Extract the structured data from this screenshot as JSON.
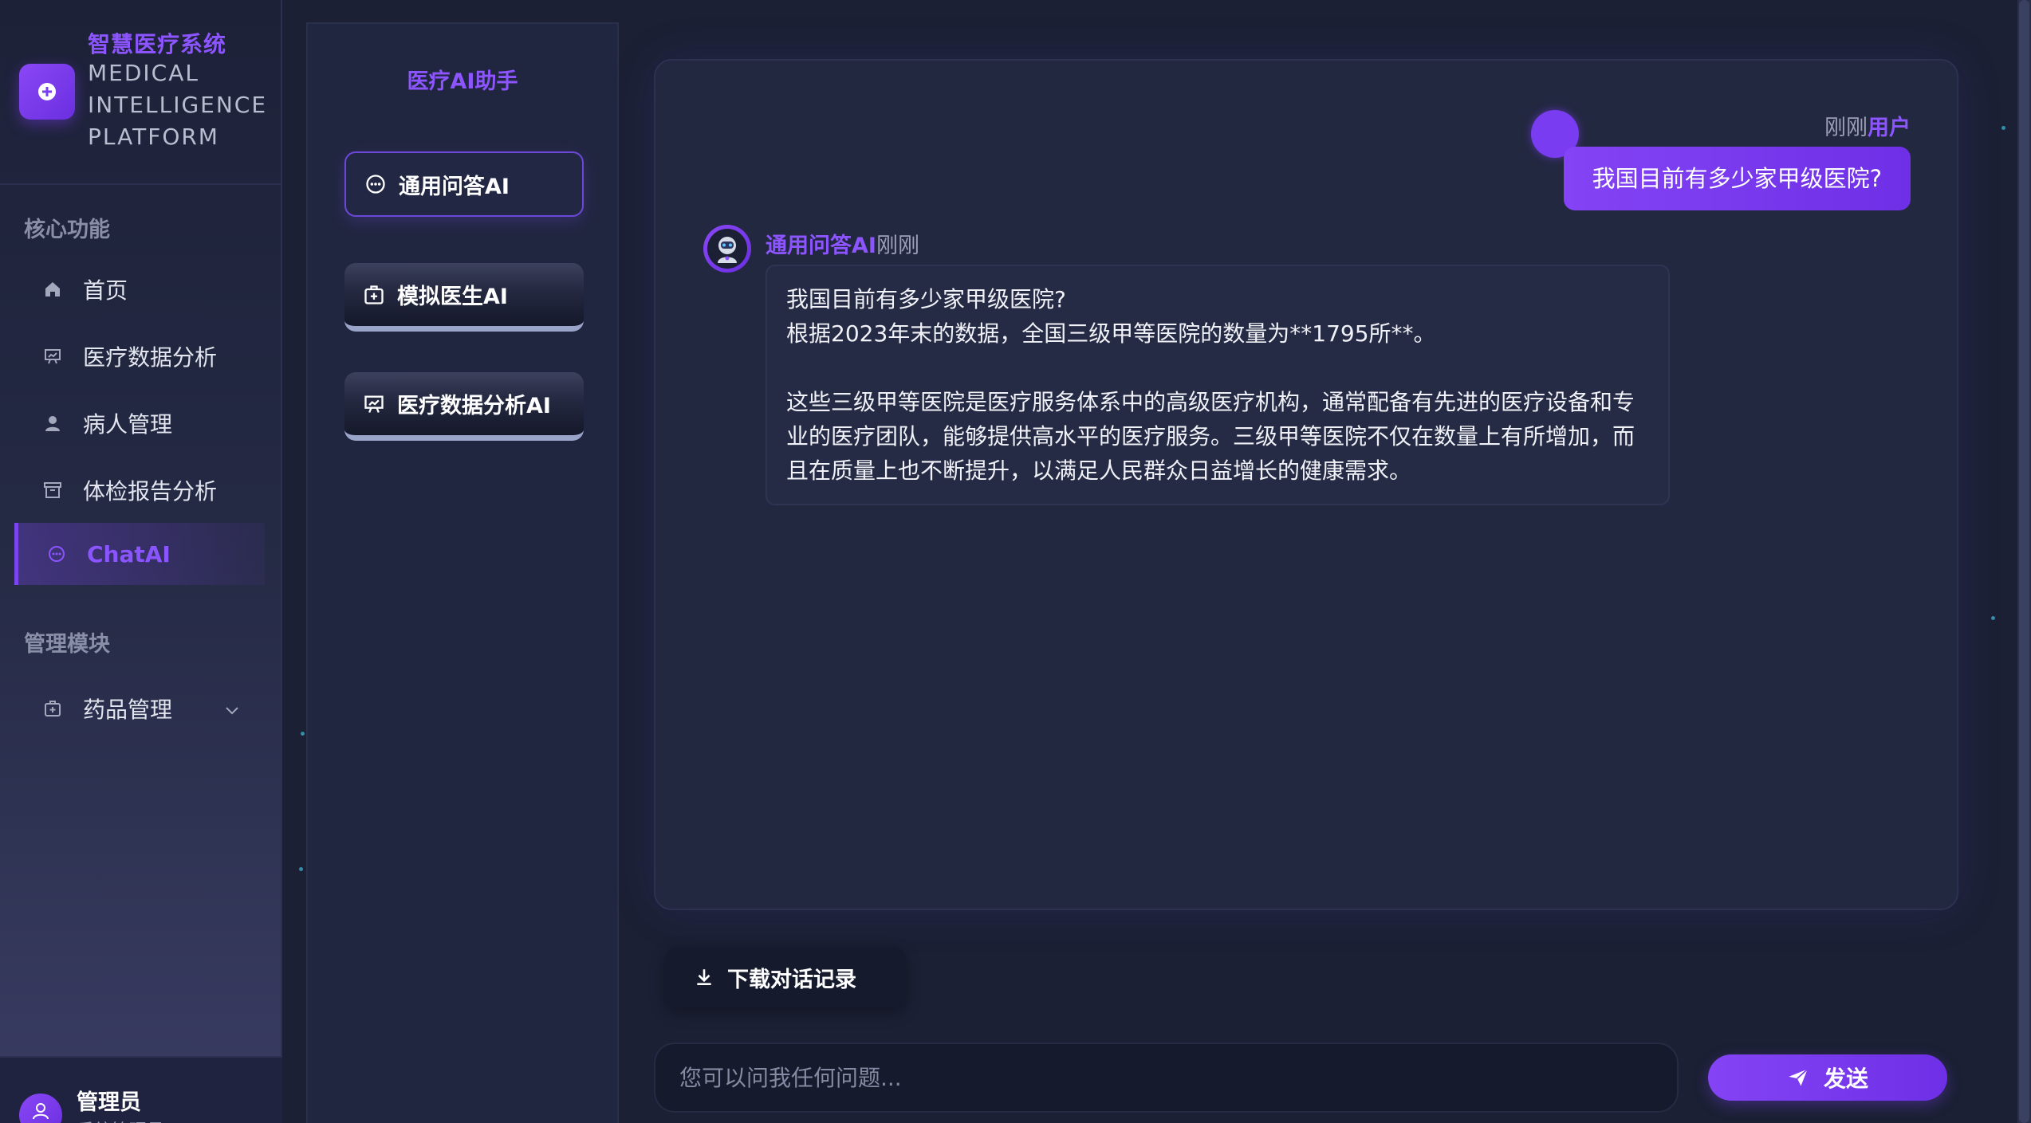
{
  "brand": {
    "title": "智慧医疗系统",
    "subtitle": "MEDICAL INTELLIGENCE PLATFORM"
  },
  "sidebar": {
    "core_section": "核心功能",
    "admin_section": "管理模块",
    "items": [
      {
        "label": "首页",
        "icon": "home-icon"
      },
      {
        "label": "医疗数据分析",
        "icon": "presentation-chart-icon"
      },
      {
        "label": "病人管理",
        "icon": "user-icon"
      },
      {
        "label": "体检报告分析",
        "icon": "archive-box-icon"
      },
      {
        "label": "ChatAI",
        "icon": "chat-bubble-icon",
        "active": true
      }
    ],
    "admin_items": [
      {
        "label": "药品管理",
        "icon": "medical-kit-icon"
      }
    ],
    "footer": {
      "name": "管理员",
      "role": "系统管理员"
    }
  },
  "assistant": {
    "title": "医疗AI助手",
    "buttons": [
      {
        "label": "通用问答AI",
        "icon": "chat-bubble-icon",
        "selected": true
      },
      {
        "label": "模拟医生AI",
        "icon": "medical-kit-icon"
      },
      {
        "label": "医疗数据分析AI",
        "icon": "presentation-chart-icon"
      }
    ]
  },
  "chat": {
    "user_message": {
      "time": "刚刚",
      "name": "用户",
      "text": "我国目前有多少家甲级医院?"
    },
    "bot_message": {
      "name": "通用问答AI",
      "time": "刚刚",
      "lines": [
        "我国目前有多少家甲级医院?",
        "根据2023年末的数据，全国三级甲等医院的数量为**1795所**。",
        "",
        "这些三级甲等医院是医疗服务体系中的高级医疗机构，通常配备有先进的医疗设备和专业的医疗团队，能够提供高水平的医疗服务。三级甲等医院不仅在数量上有所增加，而且在质量上也不断提升，以满足人民群众日益增长的健康需求。"
      ]
    }
  },
  "controls": {
    "download_label": "下载对话记录",
    "input_placeholder": "您可以问我任何问题...",
    "input_value": "",
    "send_label": "发送"
  },
  "colors": {
    "accent": "#8d55ff",
    "background": "#1b2034",
    "panel": "#212640"
  }
}
